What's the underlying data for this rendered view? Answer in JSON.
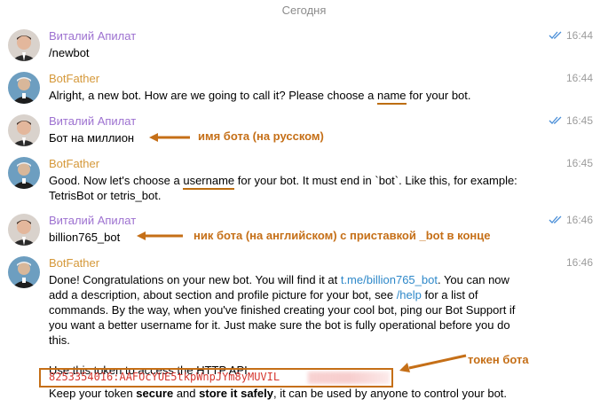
{
  "date_separator": "Сегодня",
  "messages": [
    {
      "sender": "Виталий Апилат",
      "text": "/newbot",
      "time": "16:44"
    },
    {
      "sender": "BotFather",
      "text_a": "Alright, a new bot. How are we going to call it? Please choose a ",
      "text_u": "name",
      "text_b": " for your bot.",
      "time": "16:44"
    },
    {
      "sender": "Виталий Апилат",
      "text": "Бот на миллион",
      "time": "16:45"
    },
    {
      "sender": "BotFather",
      "text_a": "Good. Now let's choose a ",
      "text_u": "username",
      "text_b": " for your bot. It must end in `bot`. Like this, for example:",
      "line2": "TetrisBot or tetris_bot.",
      "time": "16:45"
    },
    {
      "sender": "Виталий Апилат",
      "text": "billion765_bot",
      "time": "16:46"
    },
    {
      "sender": "BotFather",
      "time": "16:46",
      "l1_a": "Done! Congratulations on your new bot. You will find it at ",
      "l1_link": "t.me/billion765_bot",
      "l1_b": ". You can now",
      "l2_a": "add a description, about section and profile picture for your bot, see ",
      "l2_link": "/help",
      "l2_b": " for a list of",
      "l3": "commands. By the way, when you've finished creating your cool bot, ping our Bot Support if",
      "l4": "you want a better username for it. Just make sure the bot is fully operational before you do",
      "l5": "this.",
      "l6": "Use this token to access the HTTP API:",
      "token": "8253354016:AAFOcYUE5tkpWnpJYm8yMUVIL",
      "l7_a": "Keep your token ",
      "l7_b1": "secure",
      "l7_c": " and ",
      "l7_b2": "store it safely",
      "l7_d": ", it can be used by anyone to control your bot."
    }
  ],
  "annotations": {
    "bot_name": "имя бота (на русском)",
    "bot_nick": "ник бота (на английском) с приставкой _bot в конце",
    "bot_token": "токен бота"
  },
  "colors": {
    "user_name": "#9d71d0",
    "bot_name": "#d59839",
    "link": "#2e88c9",
    "annotation": "#c56f17",
    "token": "#d6372f"
  }
}
